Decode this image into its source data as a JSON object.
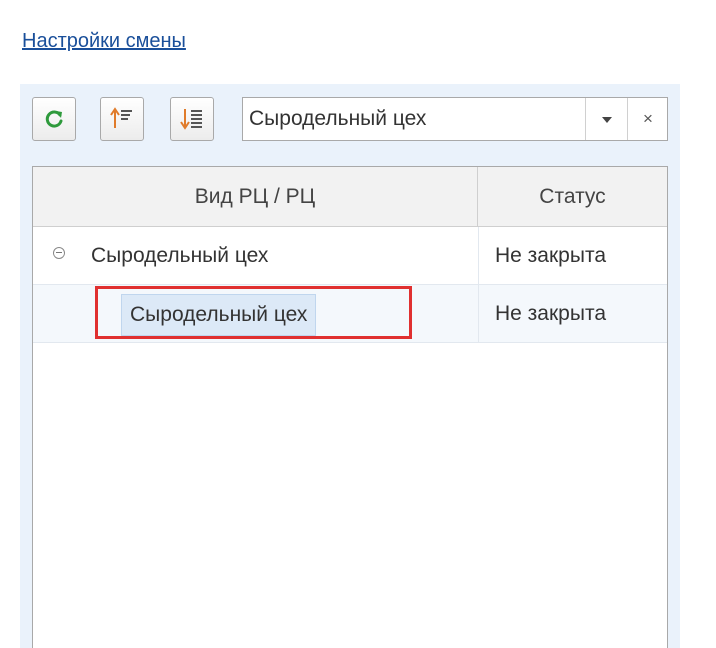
{
  "header": {
    "settings_link": "Настройки смены"
  },
  "toolbar": {
    "refresh_icon": "refresh-icon",
    "sort_asc_icon": "sort-ascending-icon",
    "sort_desc_icon": "sort-descending-icon",
    "filter_value": "Сыродельный цех",
    "clear_label": "×",
    "accent_green": "#2e9a3c",
    "accent_orange": "#e07b2a"
  },
  "grid": {
    "columns": [
      "Вид РЦ / РЦ",
      "Статус"
    ],
    "rows": [
      {
        "name": "Сыродельный цех",
        "status": "Не закрыта",
        "level": 0,
        "expanded": true
      },
      {
        "name": "Сыродельный цех",
        "status": "Не закрыта",
        "level": 1,
        "selected": true
      }
    ]
  },
  "highlight": {
    "color": "#e03030"
  }
}
